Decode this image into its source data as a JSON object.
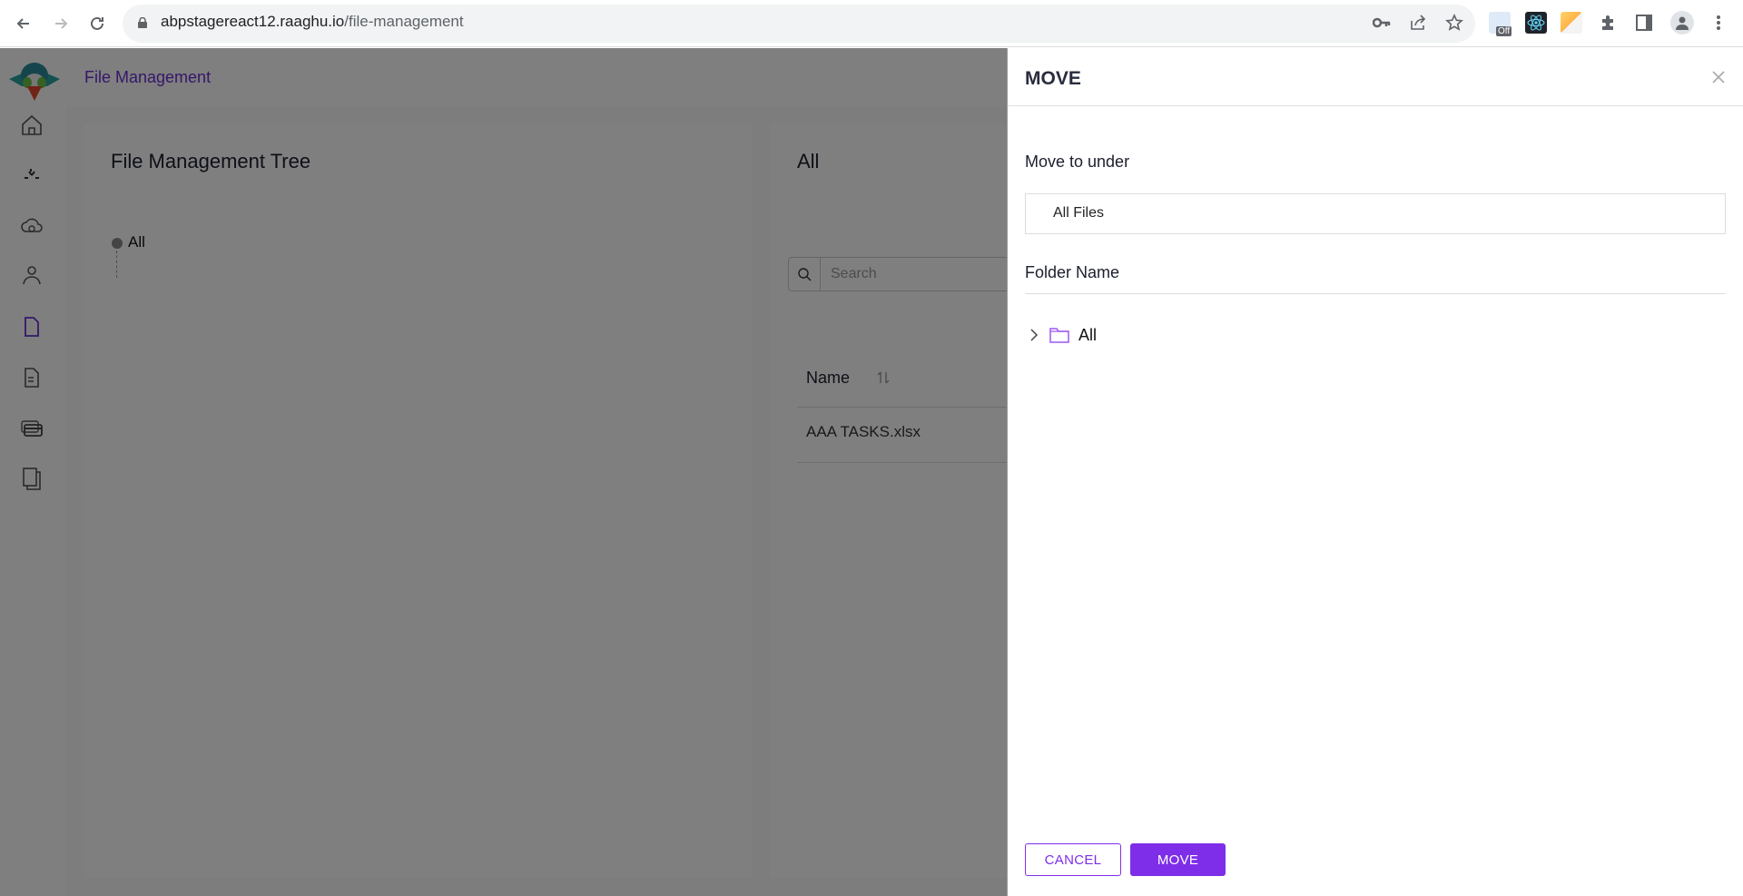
{
  "browser": {
    "url_domain": "abpstagereact12.raaghu.io",
    "url_path": "/file-management",
    "extension_badge": "Off"
  },
  "app": {
    "topbar_title": "File Management",
    "sidebar": {
      "items": [
        {
          "name": "home",
          "icon": "home-icon"
        },
        {
          "name": "dashboard",
          "icon": "sparkle-icon"
        },
        {
          "name": "cloud",
          "icon": "cloud-icon"
        },
        {
          "name": "users",
          "icon": "user-group-icon"
        },
        {
          "name": "file-management",
          "icon": "file-icon",
          "active": true
        },
        {
          "name": "documents",
          "icon": "document-icon"
        },
        {
          "name": "payments",
          "icon": "cards-icon"
        },
        {
          "name": "pages",
          "icon": "pages-icon"
        }
      ]
    },
    "tree_card": {
      "title": "File Management Tree",
      "nodes": [
        {
          "label": "All"
        }
      ]
    },
    "files_card": {
      "title": "All",
      "search_placeholder": "Search",
      "columns": [
        {
          "label": "Name",
          "sortable": true
        }
      ],
      "rows": [
        {
          "name": "AAA TASKS.xlsx"
        }
      ]
    }
  },
  "drawer": {
    "title": "MOVE",
    "move_to_label": "Move to under",
    "move_to_value": "All Files",
    "folder_name_label": "Folder Name",
    "folder_tree": [
      {
        "label": "All",
        "expanded": false
      }
    ],
    "cancel_label": "CANCEL",
    "move_label": "MOVE",
    "accent_color": "#7e2ee8"
  }
}
